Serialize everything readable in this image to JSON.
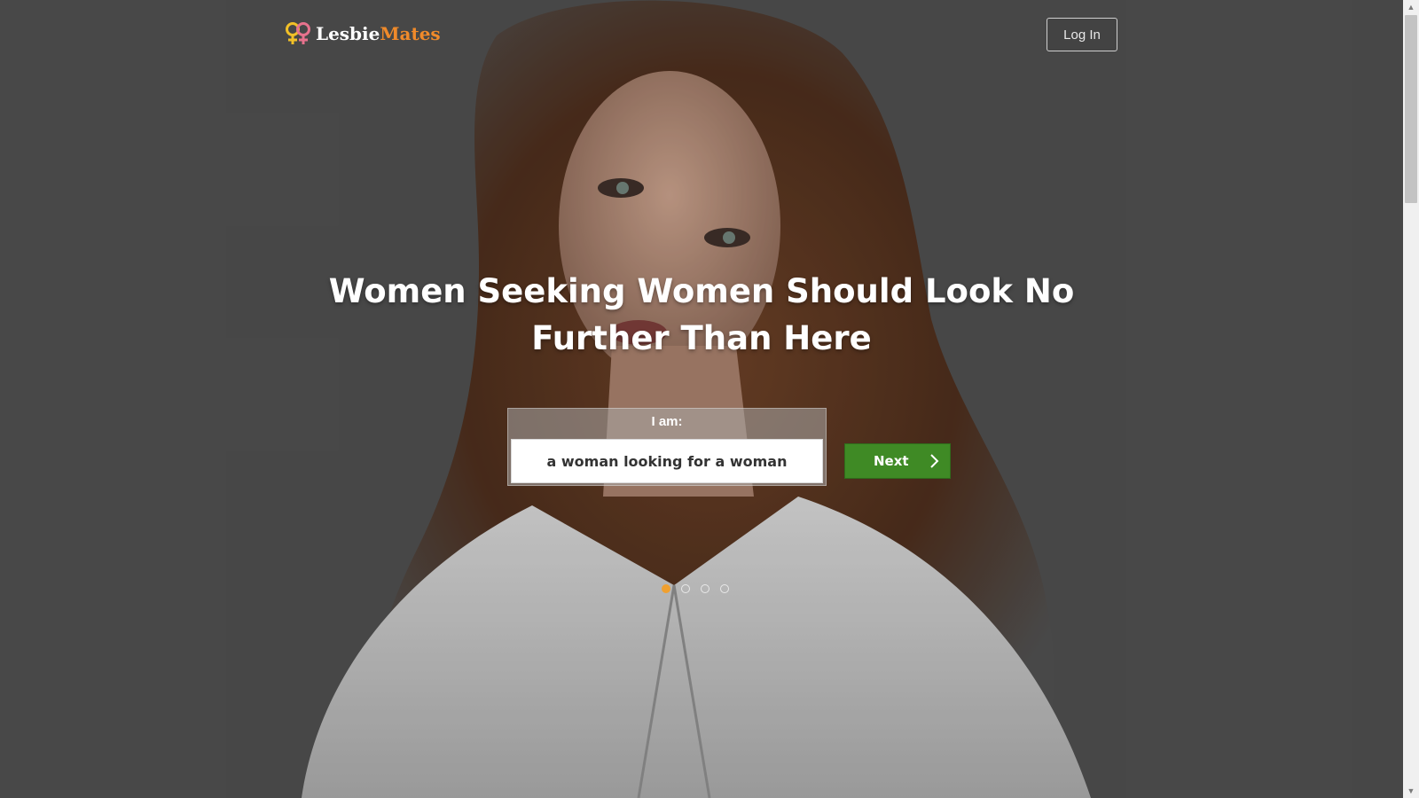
{
  "header": {
    "logo_text_a": "Lesbie",
    "logo_text_b": "Mates",
    "login_label": "Log In"
  },
  "hero": {
    "headline_line1": "Women Seeking Women Should Look No",
    "headline_line2": "Further Than Here"
  },
  "form": {
    "label": "I am:",
    "selected_value": "a woman looking for a woman",
    "next_label": "Next"
  },
  "carousel": {
    "total_slides": 4,
    "active_slide": 1
  },
  "colors": {
    "brand_orange": "#f08a2a",
    "button_green": "#3f8a25",
    "active_dot": "#f0a030"
  },
  "icons": {
    "logo": "female-symbols-icon",
    "next": "chevron-right-icon"
  }
}
